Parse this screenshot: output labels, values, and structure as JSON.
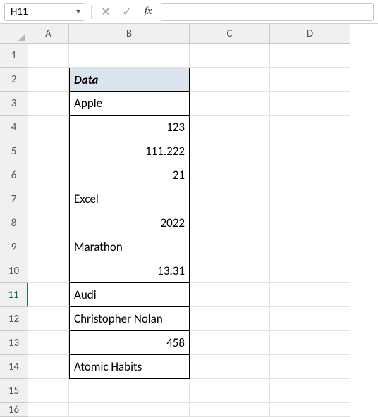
{
  "formula_bar": {
    "name_box": "H11",
    "fx_label": "fx",
    "formula_value": ""
  },
  "columns": [
    "A",
    "B",
    "C",
    "D"
  ],
  "rows": [
    "1",
    "2",
    "3",
    "4",
    "5",
    "6",
    "7",
    "8",
    "9",
    "10",
    "11",
    "12",
    "13",
    "14",
    "15",
    "16"
  ],
  "active_row": "11",
  "table": {
    "header": "Data",
    "cells": [
      {
        "value": "Apple",
        "align": "left"
      },
      {
        "value": "123",
        "align": "right"
      },
      {
        "value": "111.222",
        "align": "right"
      },
      {
        "value": "21",
        "align": "right"
      },
      {
        "value": "Excel",
        "align": "left"
      },
      {
        "value": "2022",
        "align": "right"
      },
      {
        "value": "Marathon",
        "align": "left"
      },
      {
        "value": "13.31",
        "align": "right"
      },
      {
        "value": "Audi",
        "align": "left"
      },
      {
        "value": "Christopher Nolan",
        "align": "left"
      },
      {
        "value": "458",
        "align": "right"
      },
      {
        "value": "Atomic Habits",
        "align": "left"
      }
    ]
  }
}
